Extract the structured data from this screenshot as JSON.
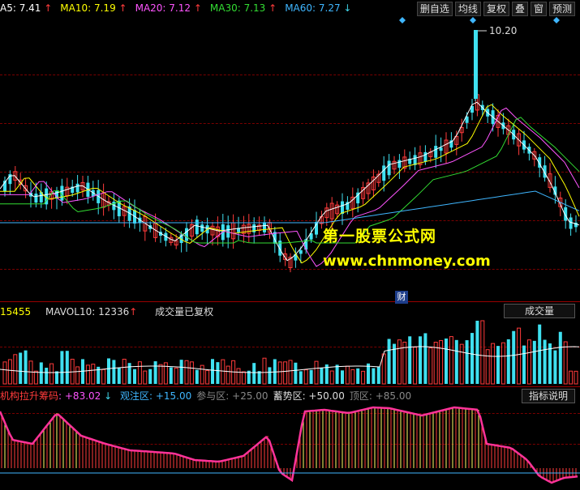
{
  "ma_bar": [
    {
      "label": "A5: 7.41",
      "color": "#ffffff",
      "arrow": "↑",
      "dir": "up"
    },
    {
      "label": "MA10: 7.19",
      "color": "#ffff00",
      "arrow": "↑",
      "dir": "up"
    },
    {
      "label": "MA20: 7.12",
      "color": "#ff55ff",
      "arrow": "↑",
      "dir": "up"
    },
    {
      "label": "MA30: 7.13",
      "color": "#33dd33",
      "arrow": "↑",
      "dir": "up"
    },
    {
      "label": "MA60: 7.27",
      "color": "#3fb6ff",
      "arrow": "↓",
      "dir": "down"
    }
  ],
  "toolbar": [
    "删自选",
    "均线",
    "复权",
    "叠",
    "窗",
    "预测"
  ],
  "price_high_label": "10.20",
  "watermark": {
    "line1": "第一股票公式网",
    "line2": "www.chnmoney.com"
  },
  "cai_marker": "财",
  "volume_bar": {
    "vol": "15455",
    "mavol_label": "MAVOL10: 12336",
    "mavol_arrow": "↑",
    "status": "成交量已复权",
    "button": "成交量"
  },
  "indicator_bar": {
    "name": "机构拉升筹码",
    "value": ": +83.02",
    "arrow": "↓",
    "zones": [
      {
        "label": "观注区: +15.00",
        "color": "#3fb6ff"
      },
      {
        "label": "参与区: +25.00",
        "color": "#888888"
      },
      {
        "label": "蓄势区: +50.00",
        "color": "#dddddd"
      },
      {
        "label": "顶区: +85.00",
        "color": "#888888"
      }
    ],
    "button": "指标说明"
  }
}
